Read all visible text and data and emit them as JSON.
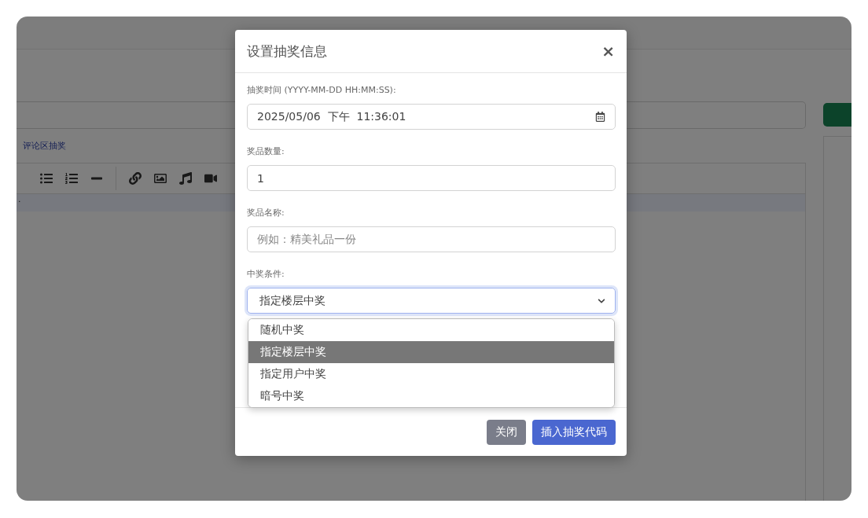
{
  "page": {
    "link": "评论区抽奖",
    "editor_line": "."
  },
  "modal": {
    "title": "设置抽奖信息",
    "close": "×",
    "fields": [
      {
        "kind": "date",
        "label": "抽奖时间 (YYYY-MM-DD HH:MM:SS):",
        "value": "2025/05/06  下午  11:36:01"
      },
      {
        "kind": "text",
        "label": "奖品数量:",
        "value": "1"
      },
      {
        "kind": "text",
        "label": "奖品名称:",
        "placeholder": "例如：精美礼品一份"
      },
      {
        "kind": "select",
        "label": "中奖条件:",
        "value": "指定楼层中奖",
        "expanded": true,
        "options": [
          {
            "label": "随机中奖",
            "selected": false
          },
          {
            "label": "指定楼层中奖",
            "selected": true
          },
          {
            "label": "指定用户中奖",
            "selected": false
          },
          {
            "label": "暗号中奖",
            "selected": false
          }
        ]
      }
    ],
    "buttons": [
      {
        "kind": "secondary",
        "label": "关闭"
      },
      {
        "kind": "primary",
        "label": "插入抽奖代码"
      }
    ]
  }
}
